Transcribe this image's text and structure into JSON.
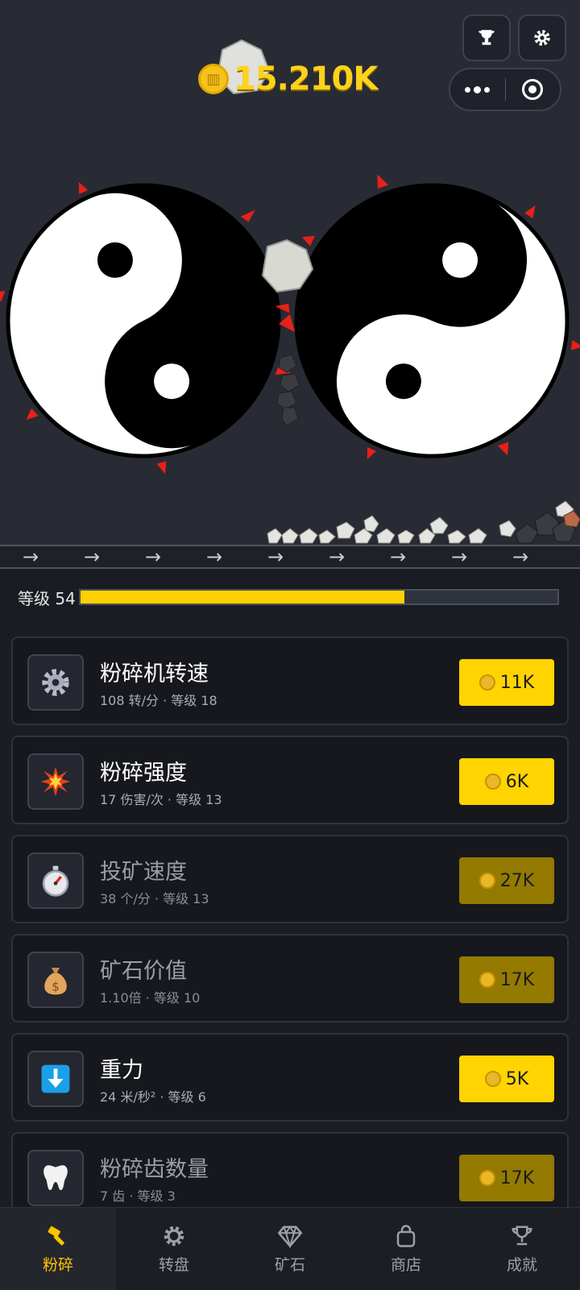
{
  "header": {
    "coins": "15.210K",
    "trophy_icon": "trophy-icon",
    "settings_icon": "gear-icon",
    "menu_icon": "more-dots-icon",
    "close_icon": "target-close-icon"
  },
  "conveyor": {
    "arrow": "→"
  },
  "level": {
    "label": "等级 54",
    "progress": 0.68
  },
  "upgrades": [
    {
      "title": "粉碎机转速",
      "sub": "108 转/分 · 等级 18",
      "price": "11K",
      "icon": "gear-icon",
      "affordable": true
    },
    {
      "title": "粉碎强度",
      "sub": "17 伤害/次 · 等级 13",
      "price": "6K",
      "icon": "explosion-icon",
      "affordable": true
    },
    {
      "title": "投矿速度",
      "sub": "38 个/分 · 等级 13",
      "price": "27K",
      "icon": "stopwatch-icon",
      "affordable": false
    },
    {
      "title": "矿石价值",
      "sub": "1.10倍 · 等级 10",
      "price": "17K",
      "icon": "money-bag-icon",
      "affordable": false
    },
    {
      "title": "重力",
      "sub": "24 米/秒² · 等级 6",
      "price": "5K",
      "icon": "down-arrow-icon",
      "affordable": true
    },
    {
      "title": "粉碎齿数量",
      "sub": "7 齿 · 等级 3",
      "price": "17K",
      "icon": "tooth-icon",
      "affordable": false
    }
  ],
  "tabs": [
    {
      "label": "粉碎",
      "icon": "hammer-icon",
      "active": true
    },
    {
      "label": "转盘",
      "icon": "gear-icon",
      "active": false
    },
    {
      "label": "矿石",
      "icon": "diamond-icon",
      "active": false
    },
    {
      "label": "商店",
      "icon": "bag-icon",
      "active": false
    },
    {
      "label": "成就",
      "icon": "trophy-icon",
      "active": false
    }
  ],
  "colors": {
    "accent": "#ffd400",
    "accent_dim": "#947a00",
    "background": "#24272f",
    "spike": "#e8201a"
  }
}
